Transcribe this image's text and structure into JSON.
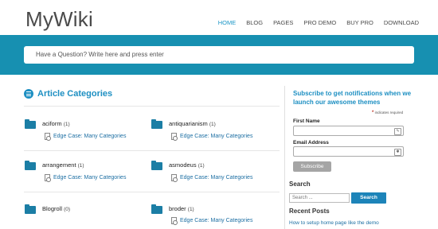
{
  "header": {
    "logo": "MyWiki",
    "nav": [
      "HOME",
      "BLOG",
      "PAGES",
      "PRO DEMO",
      "BUY PRO",
      "DOWNLOAD"
    ]
  },
  "search": {
    "placeholder": "Have a Question? Write here and press enter"
  },
  "main": {
    "section_title": "Article Categories",
    "categories": [
      {
        "name": "aciform",
        "count": "(1)",
        "link": "Edge Case: Many Categories"
      },
      {
        "name": "antiquarianism",
        "count": "(1)",
        "link": "Edge Case: Many Categories"
      },
      {
        "name": "arrangement",
        "count": "(1)",
        "link": "Edge Case: Many Categories"
      },
      {
        "name": "asmodeus",
        "count": "(1)",
        "link": "Edge Case: Many Categories"
      },
      {
        "name": "Blogroll",
        "count": "(0)",
        "link": ""
      },
      {
        "name": "broder",
        "count": "(1)",
        "link": "Edge Case: Many Categories"
      }
    ]
  },
  "sidebar": {
    "subscribe_title": "Subscribe to get notifications when we launch our awesome themes",
    "required_note": "indicates required",
    "required_mark": "*",
    "first_name_label": "First Name",
    "email_label": "Email Address",
    "subscribe_button": "Subscribe",
    "search_heading": "Search",
    "search_placeholder": "Search ...",
    "search_button": "Search",
    "recent_heading": "Recent Posts",
    "recent_posts": [
      "How to setup home page like the demo"
    ]
  },
  "colors": {
    "accent": "#1d8fc2",
    "band": "#1790b1",
    "folder": "#1b7ea5"
  }
}
